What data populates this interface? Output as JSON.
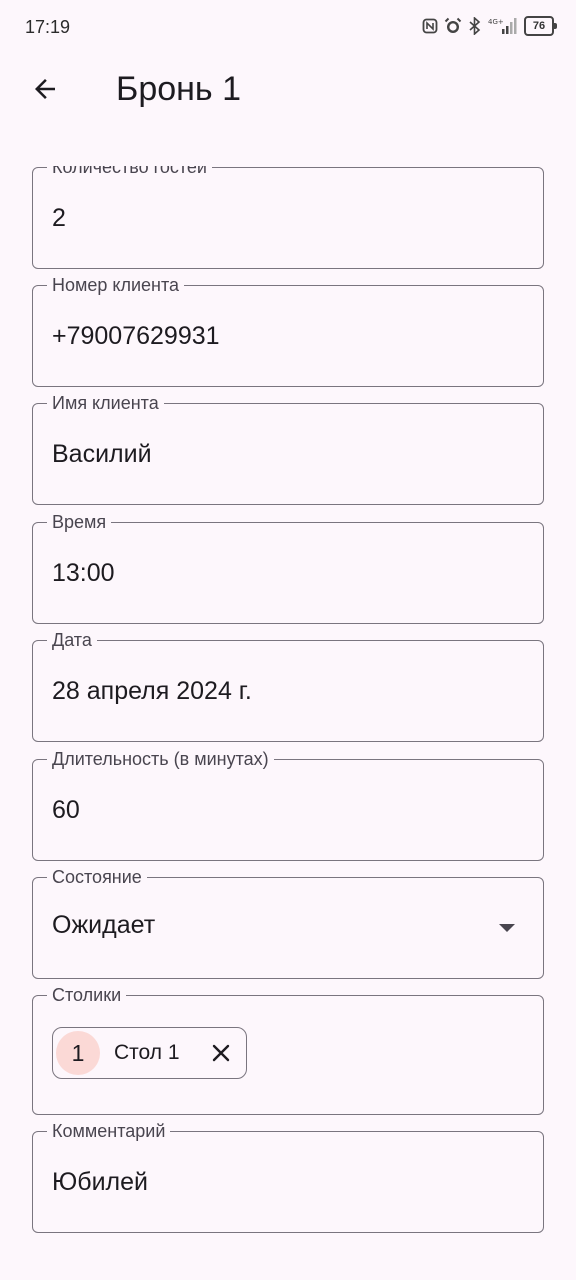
{
  "status_bar": {
    "time": "17:19",
    "battery": "76"
  },
  "app_bar": {
    "title": "Бронь 1"
  },
  "fields": {
    "guests": {
      "label": "Количество гостей",
      "value": "2"
    },
    "phone": {
      "label": "Номер клиента",
      "value": "+79007629931"
    },
    "name": {
      "label": "Имя клиента",
      "value": "Василий"
    },
    "time": {
      "label": "Время",
      "value": "13:00"
    },
    "date": {
      "label": "Дата",
      "value": "28 апреля 2024 г."
    },
    "duration": {
      "label": "Длительность (в минутах)",
      "value": "60"
    },
    "status": {
      "label": "Состояние",
      "value": "Ожидает"
    },
    "tables": {
      "label": "Столики",
      "chips": [
        {
          "avatar": "1",
          "label": "Стол 1"
        }
      ]
    },
    "comment": {
      "label": "Комментарий",
      "value": "Юбилей"
    }
  },
  "colors": {
    "background": "#fdf7fc",
    "outline": "#7a757f",
    "chip_avatar": "#fbd9d6"
  }
}
